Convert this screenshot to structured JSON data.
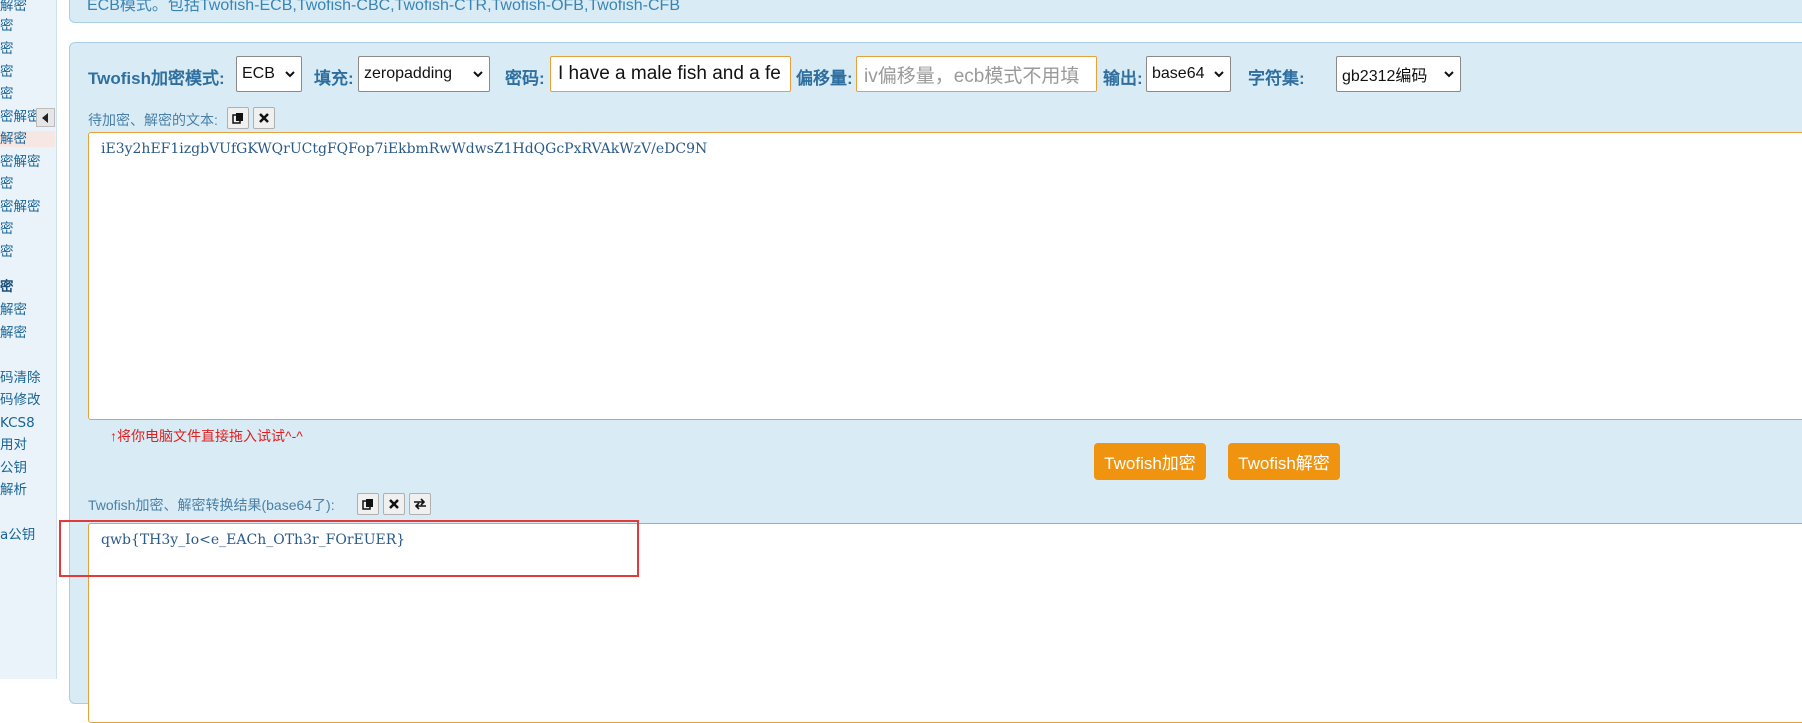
{
  "sidebar": {
    "items": [
      {
        "label": "解密"
      },
      {
        "label": "密"
      },
      {
        "label": "密"
      },
      {
        "label": "密"
      },
      {
        "label": "密"
      },
      {
        "label": "密解密"
      },
      {
        "label": "解密"
      },
      {
        "label": "密解密"
      },
      {
        "label": "密"
      },
      {
        "label": "密解密"
      },
      {
        "label": "密"
      },
      {
        "label": "密"
      },
      {
        "label": "密"
      },
      {
        "label": "解密"
      },
      {
        "label": "解密"
      },
      {
        "label": "码清除"
      },
      {
        "label": "码修改"
      },
      {
        "label": "KCS8"
      },
      {
        "label": "用对"
      },
      {
        "label": "公钥"
      },
      {
        "label": "解析"
      },
      {
        "label": "a公钥"
      }
    ]
  },
  "top_card": {
    "description": "ECB模式。包括Twofish-ECB,Twofish-CBC,Twofish-CTR,Twofish-OFB,Twofish-CFB"
  },
  "controls": {
    "mode_label": "Twofish加密模式:",
    "mode_value": "ECB",
    "padding_label": "填充:",
    "padding_value": "zeropadding",
    "password_label": "密码:",
    "password_value": "I have a male fish and a fe",
    "offset_label": "偏移量:",
    "offset_placeholder": "iv偏移量，ecb模式不用填",
    "output_label": "输出:",
    "output_value": "base64",
    "charset_label": "字符集:",
    "charset_value": "gb2312编码"
  },
  "input": {
    "label": "待加密、解密的文本:",
    "value": "iE3y2hEF1izgbVUfGKWQrUCtgFQFop7iEkbmRwWdwsZ1HdQGcPxRVAkWzV/eDC9N",
    "hint": "↑将你电脑文件直接拖入试试^-^"
  },
  "buttons": {
    "encrypt": "Twofish加密",
    "decrypt": "Twofish解密"
  },
  "output": {
    "label": "Twofish加密、解密转换结果(base64了):",
    "value": "qwb{TH3y_Io<e_EACh_OTh3r_FOrEUER}"
  },
  "colors": {
    "panel_bg": "#d9ecf5",
    "label": "#2f6f9f",
    "button": "#f0930f",
    "field_border": "#e8a13a",
    "highlight": "#e03a3a",
    "hint": "#e02020"
  }
}
